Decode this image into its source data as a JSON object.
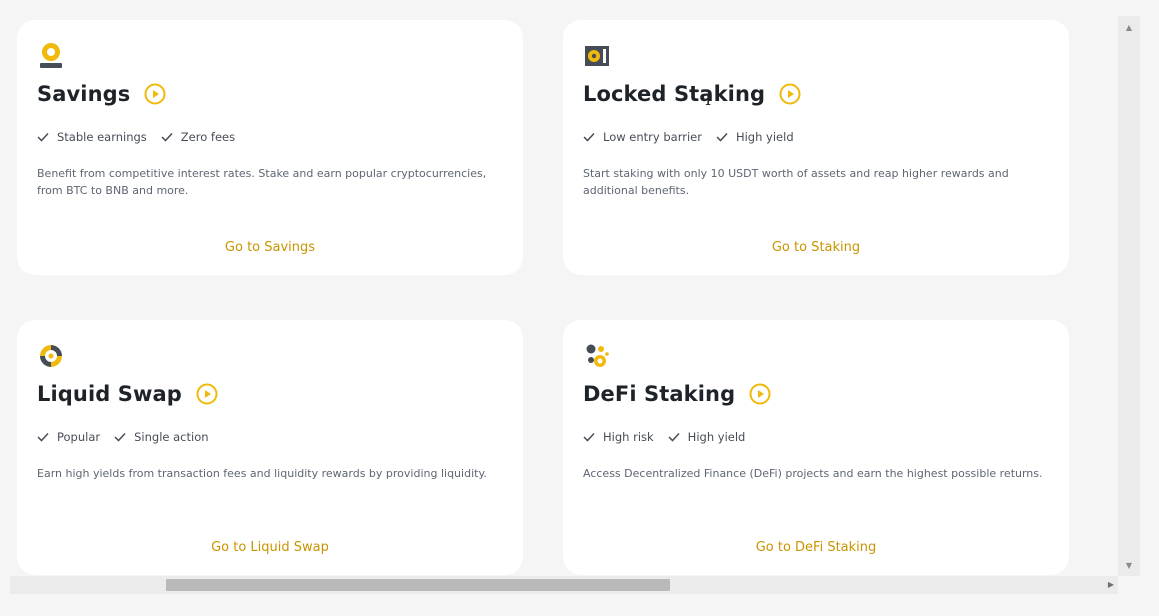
{
  "brand_colors": {
    "accent": "#f0b90b",
    "accent_text": "#c99400",
    "card_bg": "#ffffff",
    "page_bg": "#f5f5f5"
  },
  "cards": [
    {
      "icon": "savings-icon",
      "title": "Savings",
      "features": [
        "Stable earnings",
        "Zero fees"
      ],
      "description": "Benefit from competitive interest rates. Stake and earn popular cryptocurrencies, from BTC to BNB and more.",
      "cta": "Go to Savings"
    },
    {
      "icon": "locked-staking-icon",
      "title": "Locked Staking",
      "features": [
        "Low entry barrier",
        "High yield"
      ],
      "description": "Start staking with only 10 USDT worth of assets and reap higher rewards and additional benefits.",
      "cta": "Go to Staking"
    },
    {
      "icon": "liquid-swap-icon",
      "title": "Liquid Swap",
      "features": [
        "Popular",
        "Single action"
      ],
      "description": "Earn high yields from transaction fees and liquidity rewards by providing liquidity.",
      "cta": "Go to Liquid Swap"
    },
    {
      "icon": "defi-staking-icon",
      "title": "DeFi Staking",
      "features": [
        "High risk",
        "High yield"
      ],
      "description": "Access Decentralized Finance (DeFi) projects and earn the highest possible returns.",
      "cta": "Go to DeFi Staking"
    }
  ]
}
